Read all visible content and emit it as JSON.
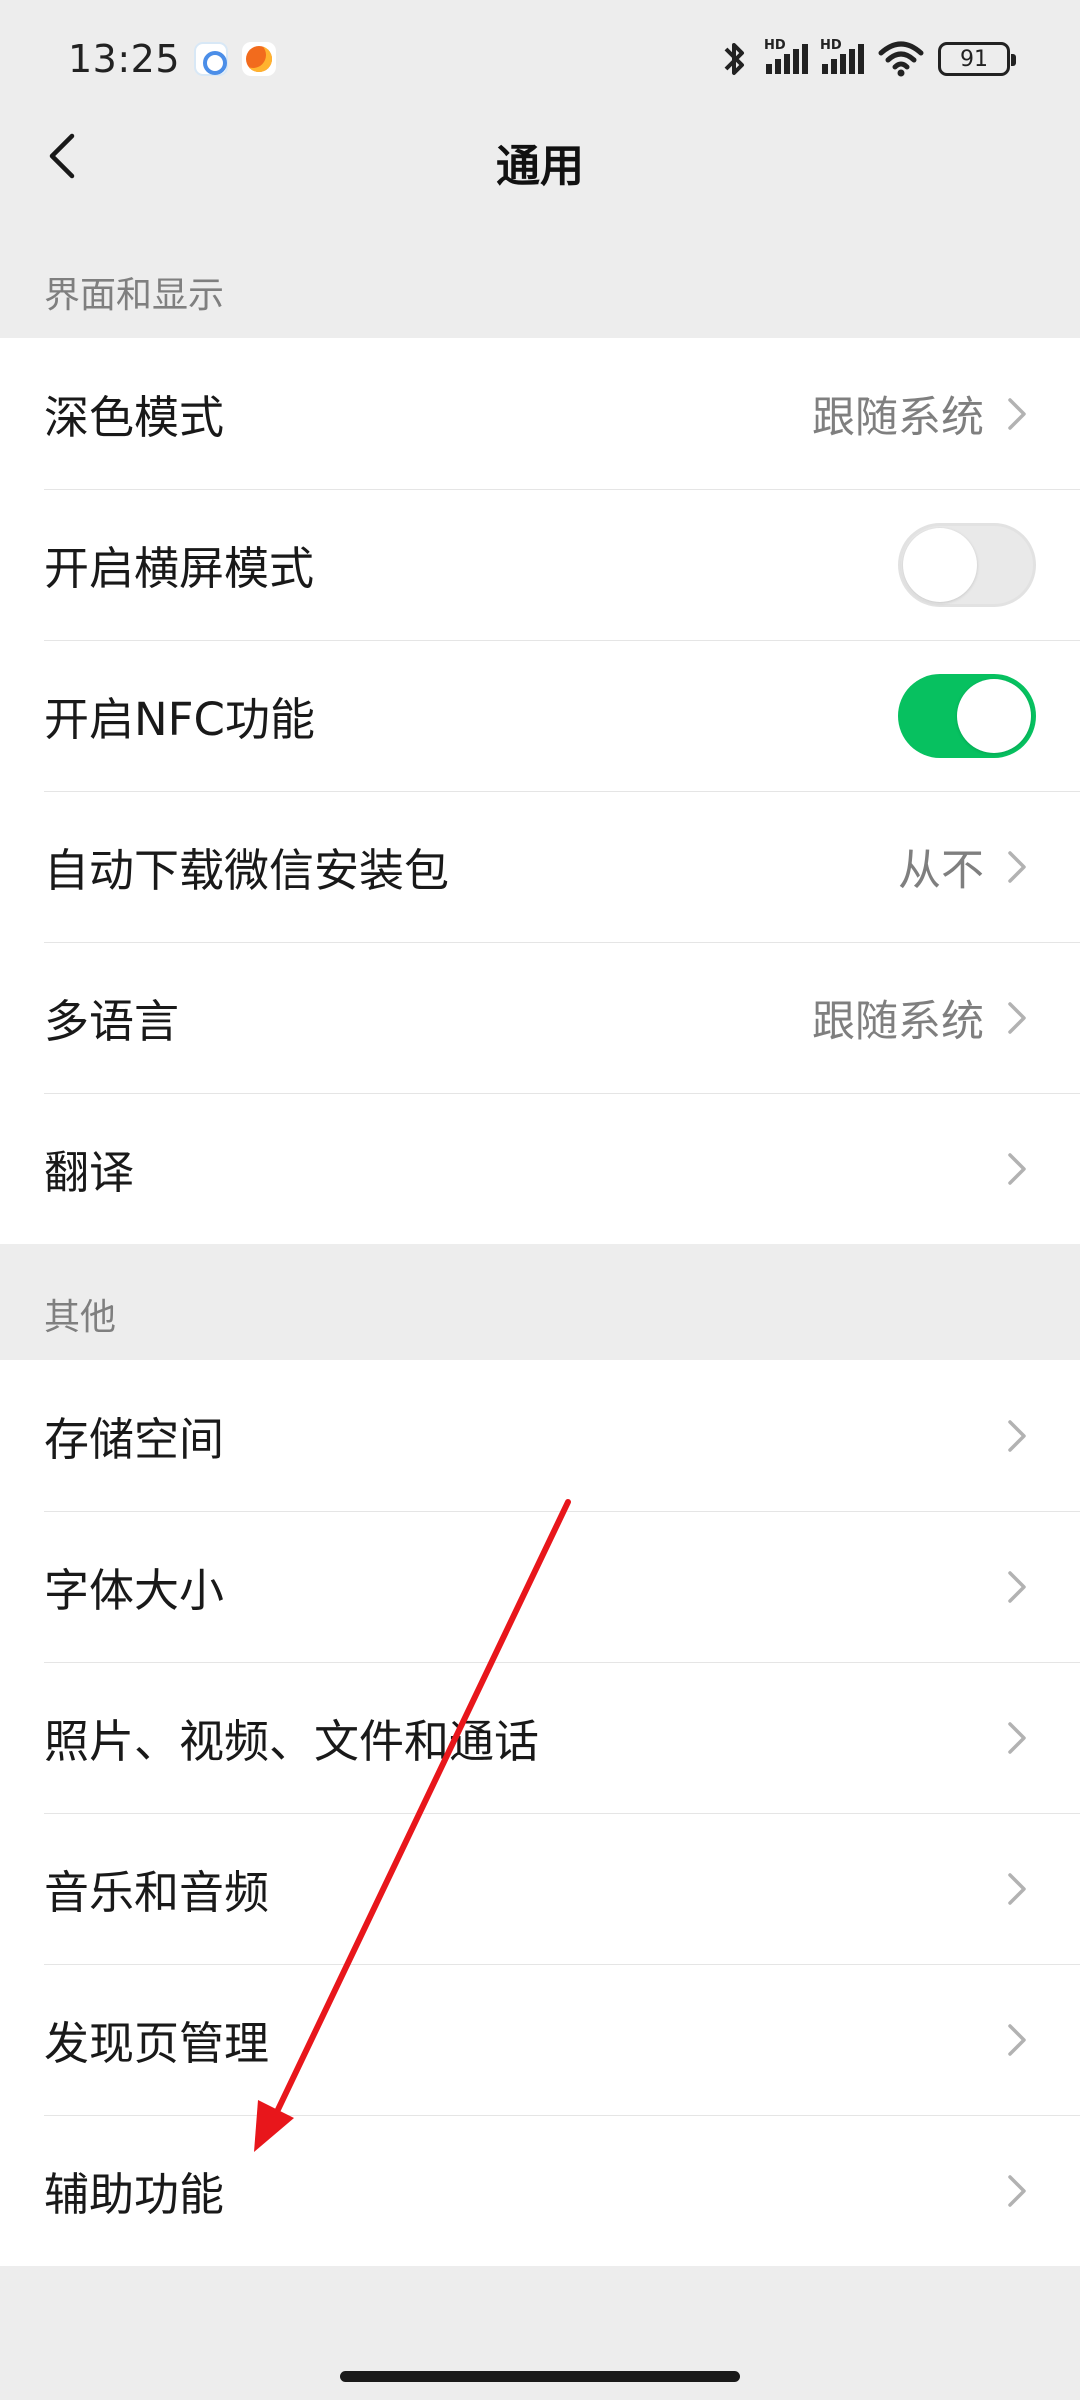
{
  "status_bar": {
    "time": "13:25",
    "app_icons": [
      "assistant-app-icon",
      "orange-app-icon"
    ],
    "signal_label_1": "HD",
    "signal_label_2": "HD",
    "battery": "91"
  },
  "nav": {
    "back_icon": "chevron-left-icon",
    "title": "通用"
  },
  "sections": [
    {
      "header": "界面和显示",
      "rows": [
        {
          "label": "深色模式",
          "value": "跟随系统",
          "control": "chevron"
        },
        {
          "label": "开启横屏模式",
          "value": "",
          "control": "toggle",
          "toggle_on": false
        },
        {
          "label": "开启NFC功能",
          "value": "",
          "control": "toggle",
          "toggle_on": true
        },
        {
          "label": "自动下载微信安装包",
          "value": "从不",
          "control": "chevron"
        },
        {
          "label": "多语言",
          "value": "跟随系统",
          "control": "chevron"
        },
        {
          "label": "翻译",
          "value": "",
          "control": "chevron"
        }
      ]
    },
    {
      "header": "其他",
      "rows": [
        {
          "label": "存储空间",
          "control": "chevron"
        },
        {
          "label": "字体大小",
          "control": "chevron"
        },
        {
          "label": "照片、视频、文件和通话",
          "control": "chevron"
        },
        {
          "label": "音乐和音频",
          "control": "chevron"
        },
        {
          "label": "发现页管理",
          "control": "chevron"
        },
        {
          "label": "辅助功能",
          "control": "chevron"
        }
      ]
    }
  ],
  "colors": {
    "accent_green": "#07c160",
    "annotation_red": "#e8161b",
    "background": "#ededed"
  }
}
